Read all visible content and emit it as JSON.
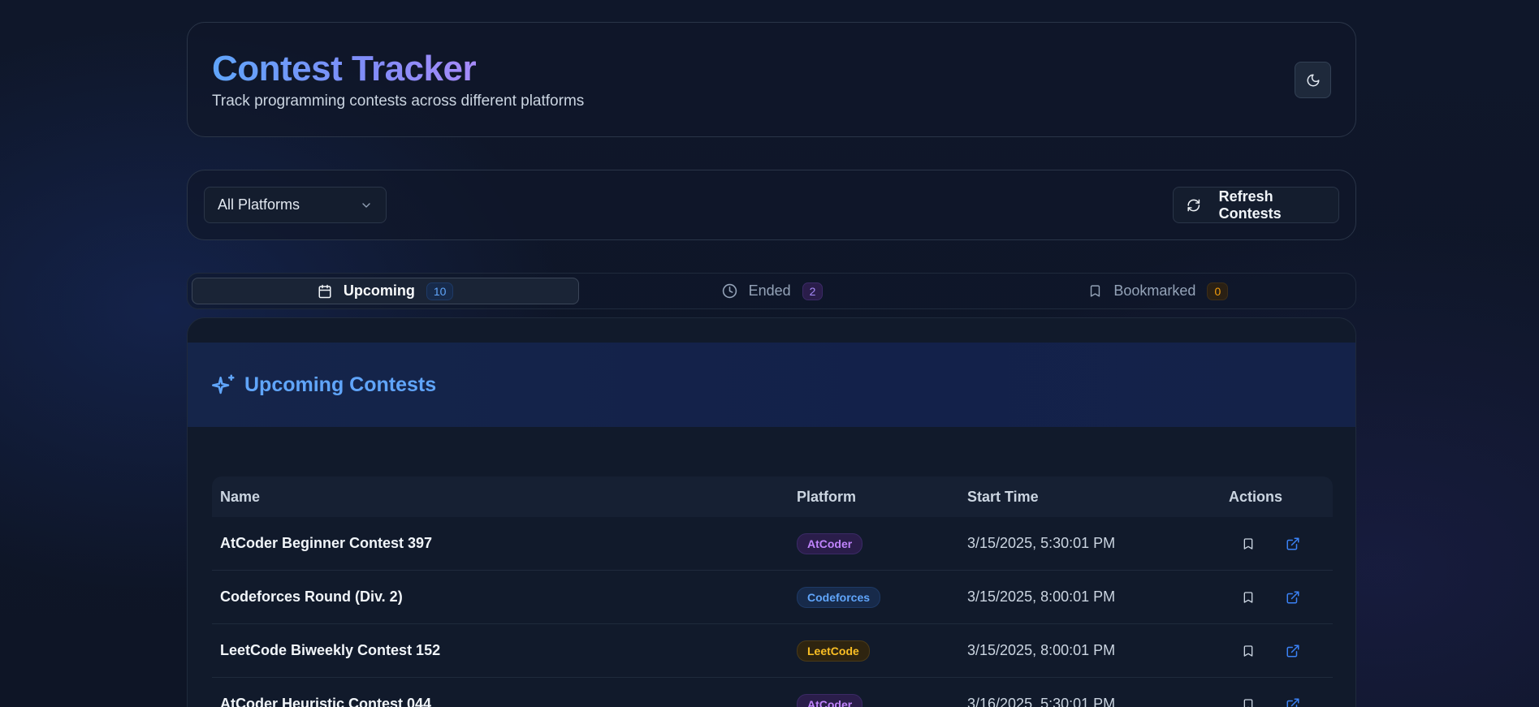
{
  "header": {
    "title": "Contest Tracker",
    "subtitle": "Track programming contests across different platforms",
    "theme_toggle_icon": "moon-icon"
  },
  "filters": {
    "platform_select": "All Platforms",
    "refresh_label": "Refresh Contests"
  },
  "tabs": [
    {
      "label": "Upcoming",
      "count": "10",
      "icon": "calendar-icon",
      "active": true
    },
    {
      "label": "Ended",
      "count": "2",
      "icon": "clock-icon",
      "active": false
    },
    {
      "label": "Bookmarked",
      "count": "0",
      "icon": "bookmark-icon",
      "active": false
    }
  ],
  "section": {
    "title": "Upcoming Contests",
    "icon": "sparkles-icon"
  },
  "table": {
    "headers": {
      "name": "Name",
      "platform": "Platform",
      "start": "Start Time",
      "actions": "Actions"
    },
    "rows": [
      {
        "name": "AtCoder Beginner Contest 397",
        "platform": "AtCoder",
        "start": "3/15/2025, 5:30:01 PM"
      },
      {
        "name": "Codeforces Round (Div. 2)",
        "platform": "Codeforces",
        "start": "3/15/2025, 8:00:01 PM"
      },
      {
        "name": "LeetCode Biweekly Contest 152",
        "platform": "LeetCode",
        "start": "3/15/2025, 8:00:01 PM"
      },
      {
        "name": "AtCoder Heuristic Contest 044",
        "platform": "AtCoder",
        "start": "3/16/2025, 5:30:01 PM"
      }
    ]
  },
  "colors": {
    "accent_blue": "#60a5fa",
    "atcoder": "#c084fc",
    "codeforces": "#60a5fa",
    "leetcode": "#fbbf24"
  }
}
